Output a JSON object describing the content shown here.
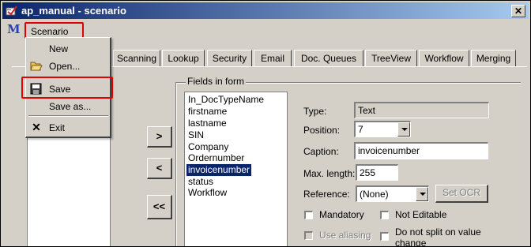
{
  "window": {
    "title": "ap_manual - scenario",
    "close_glyph": "✕"
  },
  "menubar": {
    "logo": "M",
    "scenario_label": "Scenario",
    "highlight_color": "#e00000"
  },
  "dropdown": {
    "new_label": "New",
    "open_label": "Open...",
    "save_label": "Save",
    "save_as_label": "Save as...",
    "exit_label": "Exit",
    "exit_glyph": "✕"
  },
  "tabs": [
    "Scanning",
    "Lookup",
    "Security",
    "Email",
    "Doc. Queues",
    "TreeView",
    "Workflow",
    "Merging"
  ],
  "move_buttons": {
    "add": ">",
    "remove": "<",
    "remove_all": "<<"
  },
  "fields_group": {
    "title": "Fields in form",
    "items": [
      "In_DocTypeName",
      "firstname",
      "lastname",
      "SIN",
      "Company",
      "Ordernumber",
      "invoicenumber",
      "status",
      "Workflow"
    ],
    "selected_index": 6
  },
  "properties": {
    "type_label": "Type:",
    "type_value": "Text",
    "position_label": "Position:",
    "position_value": "7",
    "caption_label": "Caption:",
    "caption_value": "invoicenumber",
    "max_length_label": "Max. length:",
    "max_length_value": "255",
    "reference_label": "Reference:",
    "reference_value": "(None)",
    "set_ocr_label": "Set OCR",
    "mandatory_label": "Mandatory",
    "not_editable_label": "Not Editable",
    "use_aliasing_label": "Use aliasing",
    "do_not_split_label_1": "Do not split on value",
    "do_not_split_label_2": "change"
  },
  "colors": {
    "title_bar": "#0a246a",
    "selection": "#0a246a",
    "face": "#d4d0c8"
  }
}
